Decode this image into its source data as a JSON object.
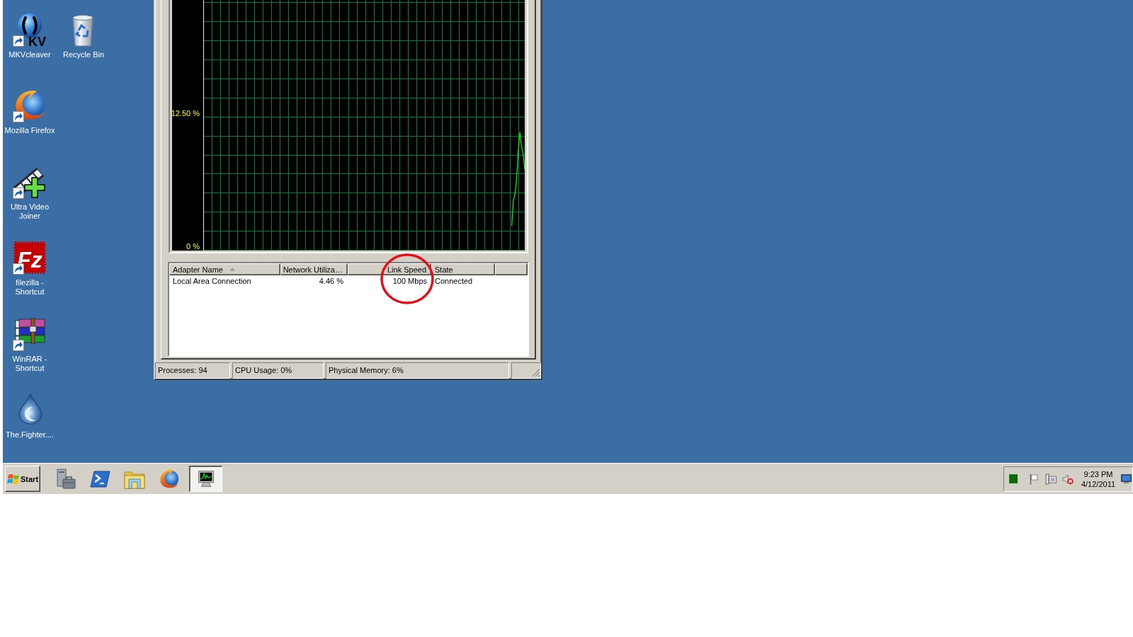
{
  "desktop": {
    "icons": [
      {
        "label": "MKVcleaver",
        "icon_text": "KV",
        "shortcut": true
      },
      {
        "label": "Recycle Bin",
        "shortcut": false
      },
      {
        "label": "Mozilla Firefox",
        "shortcut": true
      },
      {
        "label": "Ultra Video Joiner",
        "shortcut": true
      },
      {
        "label": "filezilla - Shortcut",
        "icon_text": "Fz",
        "shortcut": true
      },
      {
        "label": "WinRAR - Shortcut",
        "shortcut": true
      },
      {
        "label": "The.Fighter....",
        "shortcut": false
      }
    ]
  },
  "task_manager": {
    "network_graph": {
      "chart_data": {
        "type": "line",
        "ylim": [
          0,
          23.3
        ],
        "yticks": [
          {
            "value": 0,
            "label": "0 %"
          },
          {
            "value": 12.5,
            "label": "12.50 %"
          }
        ],
        "categories": [
          null,
          null,
          null,
          null,
          null,
          null,
          null,
          null,
          null,
          null,
          null,
          null,
          null,
          null,
          null,
          null,
          null,
          null,
          null,
          null,
          null,
          null,
          null,
          null,
          null,
          null,
          null,
          null,
          null,
          null,
          null,
          null,
          null,
          null,
          null,
          null,
          null,
          null,
          null,
          null,
          null,
          null,
          null,
          null,
          null,
          null,
          null,
          null,
          null,
          null,
          null,
          null,
          null,
          null,
          null,
          null,
          null,
          null,
          null,
          null,
          null,
          null,
          null,
          null,
          null,
          null,
          null,
          null,
          null,
          null,
          null,
          null,
          null,
          null,
          null,
          null,
          null,
          null,
          null,
          null,
          null,
          null,
          null,
          null,
          null,
          null,
          null,
          null,
          null,
          null,
          null,
          null,
          null,
          null,
          null,
          null,
          null,
          null,
          null,
          null,
          null,
          null,
          null,
          null,
          null,
          null,
          null,
          null,
          null,
          null,
          null,
          null,
          null,
          null,
          null,
          null,
          null,
          null,
          null,
          null,
          null,
          null,
          null,
          null,
          null,
          null,
          null,
          null,
          null,
          null,
          null,
          null,
          null,
          null,
          null,
          null,
          null,
          null,
          null,
          null,
          null,
          null,
          null,
          null,
          null,
          null,
          null,
          null,
          null,
          null,
          null,
          null,
          null,
          null,
          null,
          null,
          null,
          null,
          null,
          null,
          null,
          null,
          null,
          null,
          null,
          null,
          null,
          null,
          null,
          null,
          null,
          null,
          null,
          null,
          null,
          null,
          null,
          null,
          null,
          null,
          null,
          null,
          null,
          null,
          null,
          null,
          null,
          null,
          null,
          null,
          null,
          null,
          null,
          null,
          null,
          null,
          null,
          null,
          null,
          null
        ],
        "values": [
          null,
          null,
          null,
          null,
          null,
          null,
          null,
          null,
          null,
          null,
          null,
          null,
          null,
          null,
          null,
          null,
          null,
          null,
          null,
          null,
          null,
          null,
          null,
          null,
          null,
          null,
          null,
          null,
          null,
          null,
          null,
          null,
          null,
          null,
          null,
          null,
          null,
          null,
          null,
          null,
          null,
          null,
          null,
          null,
          null,
          null,
          null,
          null,
          null,
          null,
          null,
          null,
          null,
          null,
          null,
          null,
          null,
          null,
          null,
          null,
          null,
          null,
          null,
          null,
          null,
          null,
          null,
          null,
          null,
          null,
          null,
          null,
          null,
          null,
          null,
          null,
          null,
          null,
          null,
          null,
          null,
          null,
          null,
          null,
          null,
          null,
          null,
          null,
          null,
          null,
          null,
          null,
          null,
          null,
          null,
          null,
          null,
          null,
          null,
          null,
          null,
          null,
          null,
          null,
          null,
          null,
          null,
          null,
          null,
          null,
          null,
          null,
          null,
          null,
          null,
          null,
          null,
          null,
          null,
          null,
          null,
          null,
          null,
          null,
          null,
          null,
          null,
          null,
          null,
          null,
          null,
          null,
          null,
          null,
          null,
          null,
          null,
          null,
          null,
          null,
          null,
          null,
          null,
          null,
          null,
          null,
          null,
          null,
          null,
          null,
          null,
          null,
          null,
          null,
          null,
          null,
          null,
          null,
          null,
          null,
          null,
          null,
          null,
          null,
          null,
          null,
          null,
          null,
          null,
          null,
          null,
          null,
          null,
          null,
          null,
          null,
          null,
          null,
          null,
          null,
          null,
          null,
          null,
          null,
          null,
          null,
          null,
          null,
          null,
          null,
          null,
          2.3,
          4.7,
          5.2,
          6.7,
          9.3,
          11.0,
          9.7,
          9.0,
          7.5
        ]
      }
    },
    "adapters_table": {
      "columns": [
        {
          "label": "Adapter Name",
          "kind": "text",
          "sorted": true
        },
        {
          "label": "Network Utiliza…",
          "kind": "number",
          "sorted": false
        },
        {
          "label": "Link Speed",
          "kind": "number",
          "sorted": false
        },
        {
          "label": "State",
          "kind": "text",
          "sorted": false
        }
      ],
      "rows": [
        {
          "cells": [
            {
              "text": "Local Area Connection",
              "circled": false
            },
            {
              "text": "4.46 %",
              "circled": false
            },
            {
              "text": "100 Mbps",
              "circled": true
            },
            {
              "text": "Connected",
              "circled": false
            }
          ]
        }
      ]
    },
    "status_bar": [
      "Processes: 94",
      "CPU Usage: 0%",
      "Physical Memory: 6%"
    ]
  },
  "taskbar": {
    "start_button": {
      "label": "Start"
    },
    "task_buttons": [
      {
        "selected": true
      }
    ],
    "clock": {
      "time": "9:23 PM",
      "date": "4/12/2011"
    }
  }
}
